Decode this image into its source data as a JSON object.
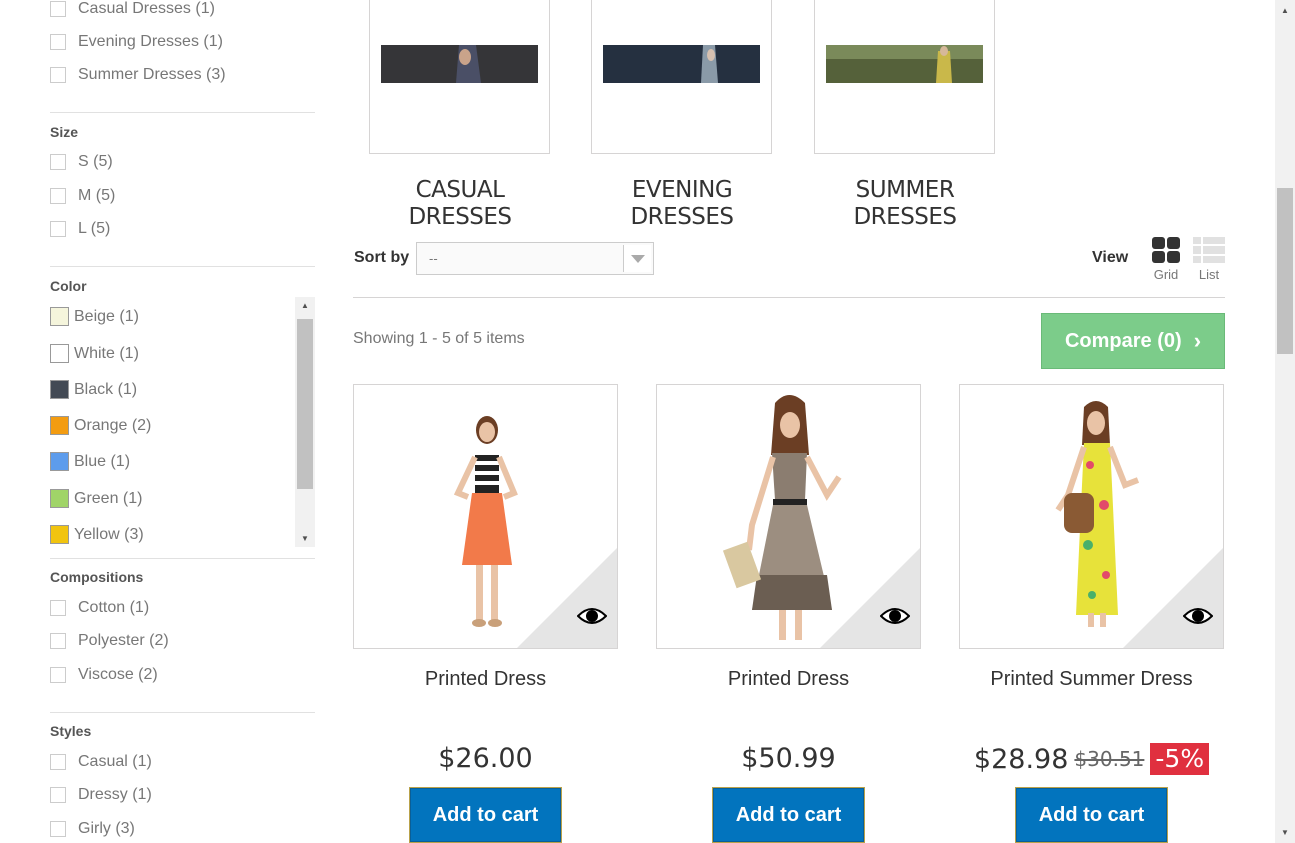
{
  "sidebar": {
    "categories": [
      {
        "label": "Casual Dresses (1)"
      },
      {
        "label": "Evening Dresses (1)"
      },
      {
        "label": "Summer Dresses (3)"
      }
    ],
    "size": {
      "title": "Size",
      "items": [
        {
          "label": "S (5)"
        },
        {
          "label": "M (5)"
        },
        {
          "label": "L (5)"
        }
      ]
    },
    "color": {
      "title": "Color",
      "items": [
        {
          "label": "Beige (1)",
          "color": "#f5f5dc"
        },
        {
          "label": "White (1)",
          "color": "#ffffff"
        },
        {
          "label": "Black (1)",
          "color": "#434a54"
        },
        {
          "label": "Orange (2)",
          "color": "#f39c11"
        },
        {
          "label": "Blue (1)",
          "color": "#5d9cec"
        },
        {
          "label": "Green (1)",
          "color": "#a0d468"
        },
        {
          "label": "Yellow (3)",
          "color": "#f1c40f"
        }
      ]
    },
    "compositions": {
      "title": "Compositions",
      "items": [
        {
          "label": "Cotton (1)"
        },
        {
          "label": "Polyester (2)"
        },
        {
          "label": "Viscose (2)"
        }
      ]
    },
    "styles": {
      "title": "Styles",
      "items": [
        {
          "label": "Casual (1)"
        },
        {
          "label": "Dressy (1)"
        },
        {
          "label": "Girly (3)"
        }
      ]
    }
  },
  "subcategories": [
    {
      "line1": "CASUAL",
      "line2": "DRESSES"
    },
    {
      "line1": "EVENING",
      "line2": "DRESSES"
    },
    {
      "line1": "SUMMER",
      "line2": "DRESSES"
    }
  ],
  "toolbar": {
    "sort_label": "Sort by",
    "sort_value": "--",
    "view_label": "View",
    "grid_label": "Grid",
    "list_label": "List",
    "showing": "Showing 1 - 5 of 5 items",
    "compare_label": "Compare (0)"
  },
  "products": [
    {
      "name": "Printed Dress",
      "price": "$26.00",
      "old_price": "",
      "discount": "",
      "cart_label": "Add to cart",
      "dress_color": "#f27a4a",
      "top_color": "#222"
    },
    {
      "name": "Printed Dress",
      "price": "$50.99",
      "old_price": "",
      "discount": "",
      "cart_label": "Add to cart",
      "dress_color": "#8b7d70",
      "top_color": "#8b7d70"
    },
    {
      "name": "Printed Summer Dress",
      "price": "$28.98",
      "old_price": "$30.51",
      "discount": "-5%",
      "cart_label": "Add to cart",
      "dress_color": "#e7e23a",
      "top_color": "#e7e23a"
    }
  ],
  "colors": {
    "compare_green": "#7ccc8a",
    "cart_blue": "#0274be",
    "discount_red": "#e0303f"
  },
  "icons": {
    "quick_view": "eye-icon",
    "grid": "grid-view-icon",
    "list": "list-view-icon",
    "compare_chevron": "chevron-right-icon"
  }
}
